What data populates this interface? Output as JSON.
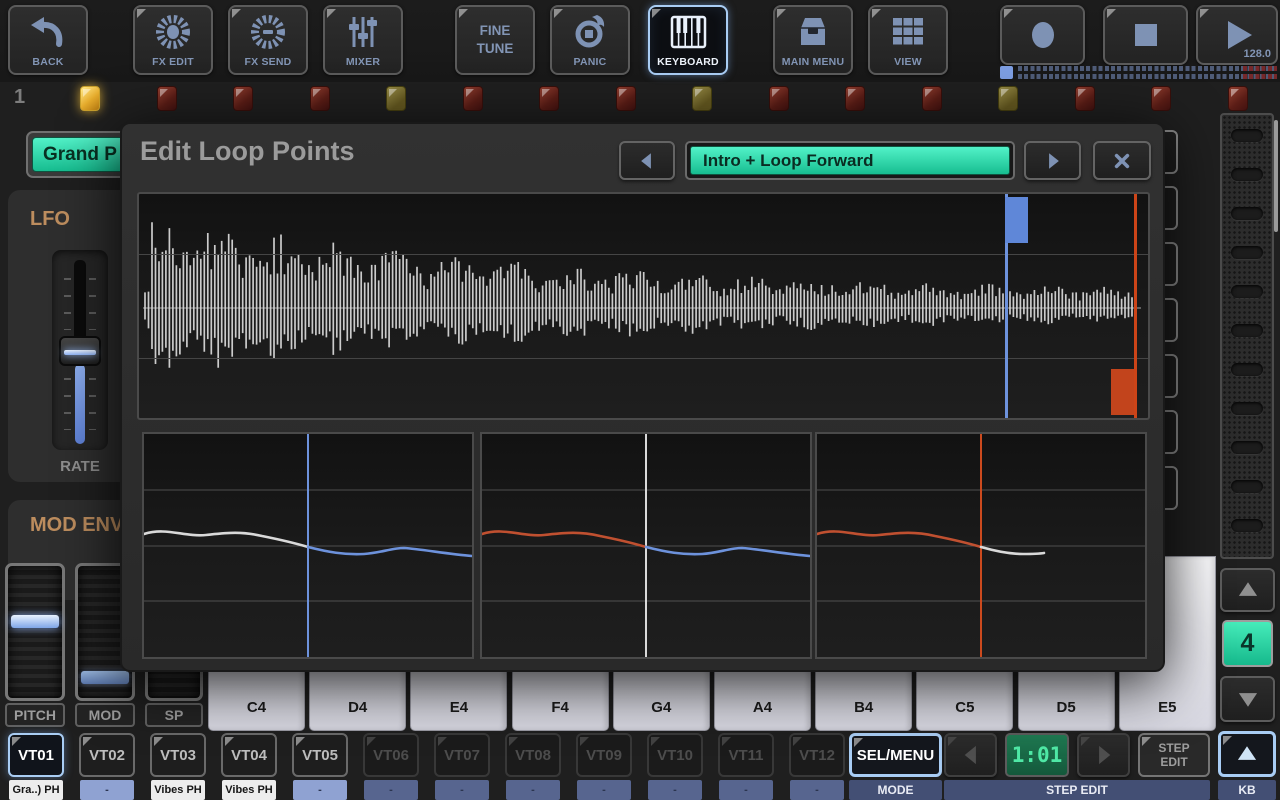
{
  "toolbar": {
    "buttons": [
      {
        "id": "back",
        "label": "BACK",
        "icon": "back-arrow",
        "fold": false,
        "selected": false
      },
      {
        "id": "fx-edit",
        "label": "FX EDIT",
        "icon": "fx-wheel",
        "fold": true,
        "selected": false
      },
      {
        "id": "fx-send",
        "label": "FX SEND",
        "icon": "fx-wheel-minus",
        "fold": true,
        "selected": false
      },
      {
        "id": "mixer",
        "label": "MIXER",
        "icon": "mixer-sliders",
        "fold": true,
        "selected": false
      },
      {
        "id": "fine-tune",
        "label": "FINE TUNE",
        "icon": null,
        "fold": true,
        "selected": false
      },
      {
        "id": "panic",
        "label": "PANIC",
        "icon": "panic-target",
        "fold": true,
        "selected": false
      },
      {
        "id": "keyboard",
        "label": "KEYBOARD",
        "icon": "piano-keys",
        "fold": true,
        "selected": true
      },
      {
        "id": "main-menu",
        "label": "MAIN MENU",
        "icon": "drawer-box",
        "fold": true,
        "selected": false
      },
      {
        "id": "view",
        "label": "VIEW",
        "icon": "grid-3x3",
        "fold": true,
        "selected": false
      }
    ],
    "transport": [
      {
        "id": "record",
        "icon": "record-circle"
      },
      {
        "id": "stop",
        "icon": "stop-square"
      },
      {
        "id": "play",
        "icon": "play-triangle",
        "tempo": "128.0"
      }
    ]
  },
  "step_row": {
    "track_number": "1",
    "pattern": [
      "gold",
      "red",
      "red",
      "red",
      "olive",
      "red",
      "red",
      "red",
      "olive",
      "red",
      "red",
      "red",
      "olive",
      "red",
      "red",
      "red"
    ]
  },
  "dialog": {
    "title": "Edit Loop Points",
    "loop_mode_value": "Intro + Loop Forward",
    "prev_icon": "left-triangle",
    "next_icon": "right-triangle",
    "close_icon": "close-x",
    "wave_view": {
      "loop_start_frac": 0.858,
      "loop_end_frac": 0.989,
      "wave_color": "#d9d9d9"
    },
    "marker_colors": {
      "blue": "#6d92dc",
      "white": "#d9d9d9",
      "red": "#c05030",
      "orange": "#cc4a1e"
    },
    "zoom_panels": [
      {
        "name": "loop-start-zoom",
        "crosshair": "blue",
        "left_wave": "white",
        "right_wave": "blue",
        "right_extent": 1.0
      },
      {
        "name": "crossfade-zoom",
        "crosshair": "white",
        "left_wave": "red",
        "right_wave": "blue",
        "right_extent": 1.0
      },
      {
        "name": "loop-end-zoom",
        "crosshair": "orange",
        "left_wave": "red",
        "right_wave": "white",
        "right_extent": 0.68
      }
    ]
  },
  "left_panel": {
    "patch_name": "Grand P",
    "lfo": {
      "title": "LFO",
      "slider_label": "RATE"
    },
    "mod_env_title": "MOD ENV",
    "wheel_labels": [
      "PITCH",
      "MOD",
      "SP"
    ]
  },
  "keyboard": {
    "keys": [
      "C4",
      "D4",
      "E4",
      "F4",
      "G4",
      "A4",
      "B4",
      "C5",
      "D5",
      "E5"
    ]
  },
  "track_bar": {
    "tracks": [
      {
        "id": "VT01",
        "sub": "Gra..) PH",
        "state": "selected",
        "sub_style": "white"
      },
      {
        "id": "VT02",
        "sub": "-",
        "state": "active",
        "sub_style": "periwinkle"
      },
      {
        "id": "VT03",
        "sub": "Vibes PH",
        "state": "active",
        "sub_style": "white"
      },
      {
        "id": "VT04",
        "sub": "Vibes PH",
        "state": "active",
        "sub_style": "white"
      },
      {
        "id": "VT05",
        "sub": "-",
        "state": "active",
        "sub_style": "periwinkle"
      },
      {
        "id": "VT06",
        "sub": "-",
        "state": "dim",
        "sub_style": "slate"
      },
      {
        "id": "VT07",
        "sub": "-",
        "state": "dim",
        "sub_style": "slate"
      },
      {
        "id": "VT08",
        "sub": "-",
        "state": "dim",
        "sub_style": "slate"
      },
      {
        "id": "VT09",
        "sub": "-",
        "state": "dim",
        "sub_style": "slate"
      },
      {
        "id": "VT10",
        "sub": "-",
        "state": "dim",
        "sub_style": "slate"
      },
      {
        "id": "VT11",
        "sub": "-",
        "state": "dim",
        "sub_style": "slate"
      },
      {
        "id": "VT12",
        "sub": "-",
        "state": "dim",
        "sub_style": "slate"
      }
    ],
    "sel_menu_label": "SEL/MENU",
    "mode_label": "MODE",
    "position_value": "1:01",
    "step_edit_strip_label": "STEP EDIT",
    "step_edit_button_label": "STEP EDIT",
    "kb_label": "KB"
  },
  "right_panel": {
    "octave_value": "4"
  }
}
